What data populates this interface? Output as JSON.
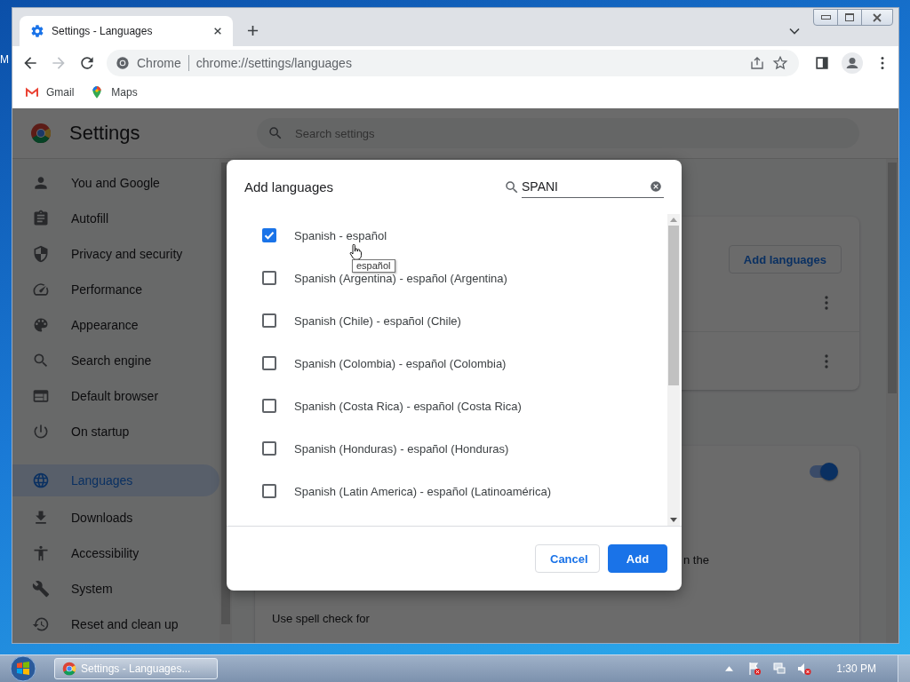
{
  "desktop": {
    "label": "M"
  },
  "browser": {
    "tabs": [
      {
        "title": "Settings - Languages",
        "selected": true
      }
    ],
    "omnibox": {
      "site": "Chrome",
      "url": "chrome://settings/languages"
    },
    "bookmarks": [
      {
        "label": "Gmail"
      },
      {
        "label": "Maps"
      }
    ]
  },
  "settings": {
    "title": "Settings",
    "search": {
      "placeholder": "Search settings"
    },
    "sidebar": [
      {
        "label": "You and Google",
        "selected": false
      },
      {
        "label": "Autofill",
        "selected": false
      },
      {
        "label": "Privacy and security",
        "selected": false
      },
      {
        "label": "Performance",
        "selected": false
      },
      {
        "label": "Appearance",
        "selected": false
      },
      {
        "label": "Search engine",
        "selected": false
      },
      {
        "label": "Default browser",
        "selected": false
      },
      {
        "label": "On startup",
        "selected": false
      },
      {
        "label": "Languages",
        "selected": true
      },
      {
        "label": "Downloads",
        "selected": false
      },
      {
        "label": "Accessibility",
        "selected": false
      },
      {
        "label": "System",
        "selected": false
      },
      {
        "label": "Reset and clean up",
        "selected": false
      }
    ],
    "add_languages_button": "Add languages",
    "spell_check_toggle": {
      "on": true
    },
    "partial_text": "n the",
    "spell_check_label": "Use spell check for"
  },
  "dialog": {
    "title": "Add languages",
    "search": {
      "value": "SPANI"
    },
    "languages": [
      {
        "label": "Spanish - español",
        "checked": true
      },
      {
        "label": "Spanish (Argentina) - español (Argentina)",
        "checked": false
      },
      {
        "label": "Spanish (Chile) - español (Chile)",
        "checked": false
      },
      {
        "label": "Spanish (Colombia) - español (Colombia)",
        "checked": false
      },
      {
        "label": "Spanish (Costa Rica) - español (Costa Rica)",
        "checked": false
      },
      {
        "label": "Spanish (Honduras) - español (Honduras)",
        "checked": false
      },
      {
        "label": "Spanish (Latin America) - español (Latinoamérica)",
        "checked": false
      }
    ],
    "tooltip": "español",
    "buttons": [
      {
        "label": "Cancel",
        "kind": "secondary"
      },
      {
        "label": "Add",
        "kind": "primary"
      }
    ]
  },
  "taskbar": {
    "task": "Settings - Languages...",
    "clock": "1:30 PM"
  }
}
